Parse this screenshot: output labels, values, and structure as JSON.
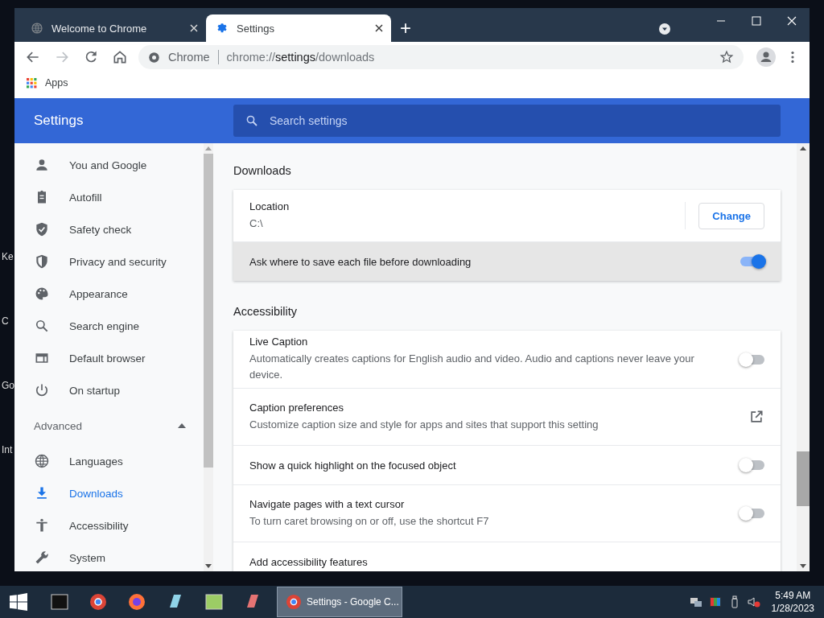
{
  "desktop_labels": [
    "Ke",
    "C",
    "Go",
    "Int"
  ],
  "window": {
    "tabs": [
      {
        "title": "Welcome to Chrome",
        "selected": false
      },
      {
        "title": "Settings",
        "selected": true
      }
    ],
    "new_tab": "+",
    "address_bar": {
      "chip": "Chrome",
      "url": {
        "scheme": "chrome://",
        "host": "settings",
        "path": "/downloads"
      }
    },
    "bookmarks": [
      "Apps"
    ]
  },
  "settings": {
    "title": "Settings",
    "search": {
      "placeholder": "Search settings"
    },
    "sidebar": {
      "items": [
        {
          "label": "You and Google",
          "selected": false
        },
        {
          "label": "Autofill",
          "selected": false
        },
        {
          "label": "Safety check",
          "selected": false
        },
        {
          "label": "Privacy and security",
          "selected": false
        },
        {
          "label": "Appearance",
          "selected": false
        },
        {
          "label": "Search engine",
          "selected": false
        },
        {
          "label": "Default browser",
          "selected": false
        },
        {
          "label": "On startup",
          "selected": false
        }
      ],
      "advanced": {
        "label": "Advanced",
        "expanded": true,
        "items": [
          {
            "label": "Languages",
            "selected": false
          },
          {
            "label": "Downloads",
            "selected": true
          },
          {
            "label": "Accessibility",
            "selected": false
          },
          {
            "label": "System",
            "selected": false
          }
        ]
      }
    },
    "sections": [
      {
        "title": "Downloads",
        "rows": [
          {
            "kind": "location",
            "label": "Location",
            "value": "C:\\",
            "button": "Change"
          },
          {
            "kind": "toggle",
            "label": "Ask where to save each file before downloading",
            "on": true
          }
        ]
      },
      {
        "title": "Accessibility",
        "rows": [
          {
            "kind": "toggle",
            "label": "Live Caption",
            "description": "Automatically creates captions for English audio and video. Audio and captions never leave your device.",
            "on": false
          },
          {
            "kind": "link",
            "label": "Caption preferences",
            "description": "Customize caption size and style for apps and sites that support this setting"
          },
          {
            "kind": "toggle",
            "label": "Show a quick highlight on the focused object",
            "on": false
          },
          {
            "kind": "toggle",
            "label": "Navigate pages with a text cursor",
            "description": "To turn caret browsing on or off, use the shortcut F7",
            "on": false
          },
          {
            "kind": "plain",
            "label": "Add accessibility features"
          }
        ]
      }
    ]
  },
  "taskbar": {
    "active_window": "Settings - Google C...",
    "time": "5:49 AM",
    "date": "1/28/2023"
  }
}
